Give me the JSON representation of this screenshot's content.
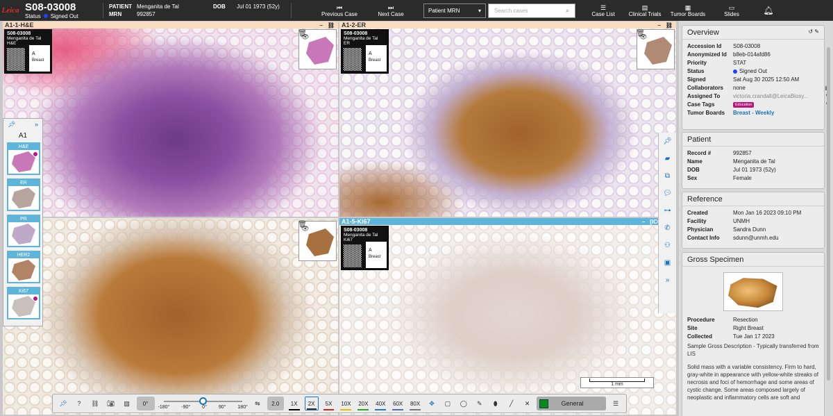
{
  "header": {
    "logo": "Leica",
    "case_id": "S08-03008",
    "status_label": "Status",
    "status_value": "Signed Out",
    "patient_label": "PATIENT",
    "patient_name": "Menganita de Tal",
    "dob_label": "DOB",
    "dob_value": "Jul 01 1973 (52y)",
    "mrn_label": "MRN",
    "mrn_value": "992857",
    "prev_case": "Previous Case",
    "next_case": "Next Case",
    "search_type": "Patient MRN",
    "search_placeholder": "Search cases",
    "case_list": "Case List",
    "clinical_trials": "Clinical Trials",
    "tumor_boards": "Tumor Boards",
    "slides": "Slides"
  },
  "panes": [
    {
      "title": "A1-1-H&E",
      "label_case": "S08-03008",
      "label_name": "Menganita de Tal",
      "label_stain": "H&E",
      "label_part": "A",
      "label_site": "Breast"
    },
    {
      "title": "A1-2-ER",
      "label_case": "S08-03008",
      "label_name": "Menganita de Tal",
      "label_stain": "ER",
      "label_part": "A",
      "label_site": "Breast"
    },
    {
      "title": "",
      "label_case": "",
      "label_name": "",
      "label_stain": "",
      "label_part": "",
      "label_site": ""
    },
    {
      "title": "A1-5-Ki67",
      "label_case": "S08-03008",
      "label_name": "Menganita de Tal",
      "label_stain": "Ki67",
      "label_part": "A",
      "label_site": "Breast",
      "tag": "[ICC]"
    }
  ],
  "tray": {
    "title": "A1",
    "slides": [
      "H&E",
      "ER",
      "PR",
      "HER2",
      "Ki67"
    ]
  },
  "scalebar": "1 mm",
  "toolbar": {
    "rotation": "0°",
    "rotation_ticks": [
      "-180°",
      "-90°",
      "0°",
      "90°",
      "180°"
    ],
    "zoom_value": "2.0",
    "zooms": [
      "1X",
      "2X",
      "5X",
      "10X",
      "20X",
      "40X",
      "60X",
      "80X"
    ],
    "active_zoom": "2X",
    "annotation_group": "General",
    "annotation_color": "#0b8a1c"
  },
  "overview": {
    "title": "Overview",
    "rows": [
      {
        "k": "Accession Id",
        "v": "S08-03008"
      },
      {
        "k": "Anonymized Id",
        "v": "b8eb-014afd86"
      },
      {
        "k": "Priority",
        "v": "STAT"
      },
      {
        "k": "Status",
        "v": "Signed Out"
      },
      {
        "k": "Signed",
        "v": "Sat Aug 30 2025 12:50 AM"
      },
      {
        "k": "Collaborators",
        "v": "none"
      },
      {
        "k": "Assigned To",
        "v": "victoria.crandall@LeicaBiosy..."
      },
      {
        "k": "Case Tags",
        "v": "Education"
      },
      {
        "k": "Tumor Boards",
        "v": "Breast - Weekly"
      }
    ]
  },
  "patient": {
    "title": "Patient",
    "rows": [
      {
        "k": "Record #",
        "v": "992857"
      },
      {
        "k": "Name",
        "v": "Menganita de Tal"
      },
      {
        "k": "DOB",
        "v": "Jul 01 1973 (52y)"
      },
      {
        "k": "Sex",
        "v": "Female"
      }
    ]
  },
  "reference": {
    "title": "Reference",
    "rows": [
      {
        "k": "Created",
        "v": "Mon Jan 16 2023 09:10 PM"
      },
      {
        "k": "Facility",
        "v": "UNMH"
      },
      {
        "k": "Physician",
        "v": "Sandra Dunn"
      },
      {
        "k": "Contact Info",
        "v": "sdunn@unmh.edu"
      }
    ]
  },
  "gross": {
    "title": "Gross Specimen",
    "rows": [
      {
        "k": "Procedure",
        "v": "Resection"
      },
      {
        "k": "Site",
        "v": "Right Breast"
      },
      {
        "k": "Collected",
        "v": "Tue Jan 17 2023"
      }
    ],
    "desc_title": "Sample Gross Description - Typically transferred from LIS",
    "desc": "Solid mass with a variable consistency. Firm to hard, gray-white in appearance with yellow-white streaks of necrosis and foci of hemorrhage and some areas of cystic change. Some areas composed largely of neoplastic and inflammatory cells are soft and"
  },
  "colors": {
    "topbar": "#2b2b2b",
    "accent": "#1a72b8",
    "active_pane": "#5fb5d9",
    "he_stain": "#8a4fa0",
    "dab_stain": "#a0622a"
  }
}
